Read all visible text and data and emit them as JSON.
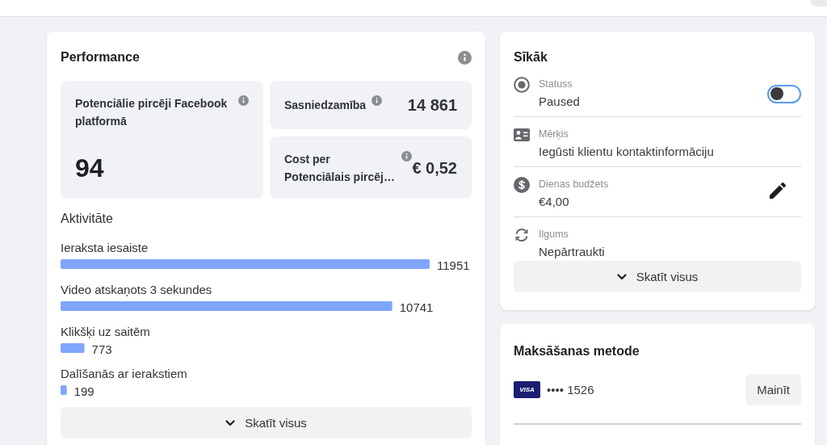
{
  "performance": {
    "title": "Performance",
    "metrics": [
      {
        "kind": "large",
        "label": "Potenciālie pircēji Facebook platformā",
        "value": "94"
      },
      {
        "kind": "inline",
        "label": "Sasniedzamība",
        "value": "14 861"
      },
      {
        "kind": "inline",
        "label": "Cost per Potenciālais pircēj…",
        "value": "€ 0,52"
      }
    ],
    "activity": {
      "title": "Aktivitāte",
      "chart_data": {
        "type": "bar",
        "orientation": "horizontal",
        "categories": [
          "Ieraksta iesaiste",
          "Video atskaņots 3 sekundes",
          "Klikšķi uz saitēm",
          "Dalīšanās ar ierakstiem"
        ],
        "values": [
          11951,
          10741,
          773,
          199
        ],
        "data_labels": true
      },
      "button": "Skatīt visus"
    }
  },
  "details": {
    "title": "Sīkāk",
    "rows": [
      {
        "kind": "status",
        "label": "Statuss",
        "value": "Paused",
        "toggle_on": false
      },
      {
        "kind": "objective",
        "label": "Mērķis",
        "value": "Iegūsti klientu kontaktinformāciju"
      },
      {
        "kind": "budget",
        "label": "Dienas budžets",
        "value": "€4,00"
      },
      {
        "kind": "duration",
        "label": "Ilgums",
        "value": "Nepārtraukti"
      }
    ],
    "button": "Skatīt visus"
  },
  "payment": {
    "title": "Maksāšanas metode",
    "card_brand": "VISA",
    "card_number": "•••• 1526",
    "button": "Mainīt"
  }
}
